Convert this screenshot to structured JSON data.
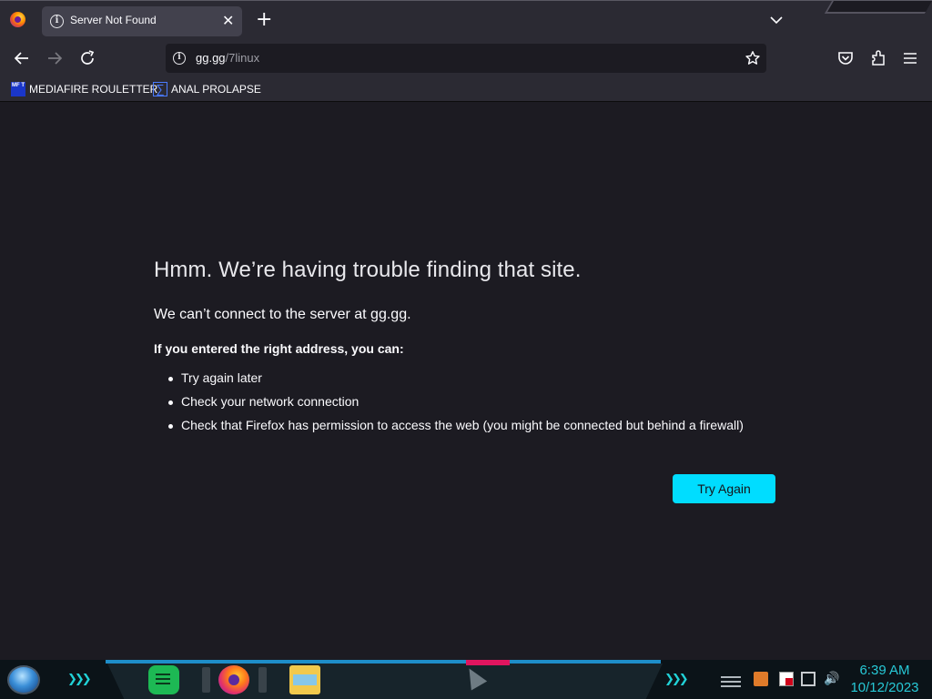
{
  "browser": {
    "tab": {
      "title": "Server Not Found",
      "close": "✕"
    },
    "new_tab": "+",
    "url": {
      "host": "gg.gg",
      "path": "/7linux"
    },
    "bookmarks": [
      {
        "label": "MEDIAFIRE ROULETTER",
        "icon": "mediafire-icon",
        "icon_text": "MF T"
      },
      {
        "label": "ANAL PROLAPSE",
        "icon": "sigma-icon",
        "icon_text": "∑"
      }
    ]
  },
  "error_page": {
    "title": "Hmm. We’re having trouble finding that site.",
    "subtitle": "We can’t connect to the server at gg.gg.",
    "lead": "If you entered the right address, you can:",
    "suggestions": [
      "Try again later",
      "Check your network connection",
      "Check that Firefox has permission to access the web (you might be connected but behind a firewall)"
    ],
    "button": "Try Again",
    "accent_color": "#00ddff"
  },
  "taskbar": {
    "chevrons": "❯❯❯",
    "clock": {
      "time": "6:39 AM",
      "date": "10/12/2023"
    },
    "apps": [
      "start-orb-icon",
      "notes-app-icon",
      "firefox-icon",
      "file-explorer-icon"
    ],
    "tray": [
      "tray-overflow-icon",
      "java-icon",
      "action-center-flag-icon",
      "network-icon",
      "volume-icon"
    ]
  }
}
